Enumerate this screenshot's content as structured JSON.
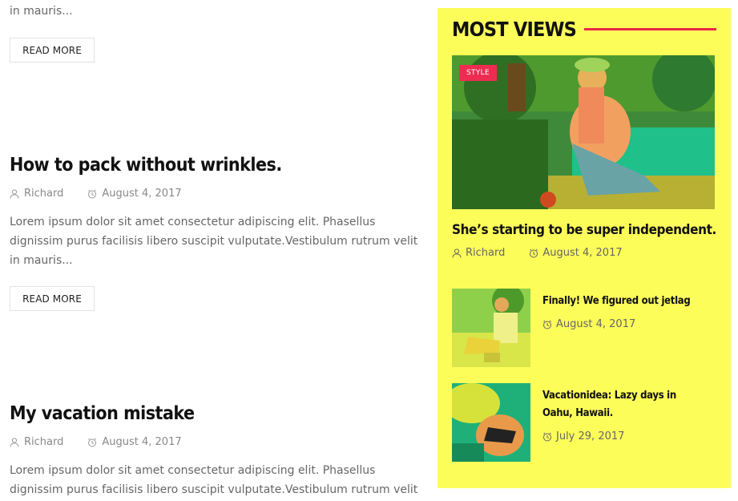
{
  "posts": [
    {
      "excerpt": "in mauris...",
      "read_more": "READ MORE"
    },
    {
      "title": "How to pack without wrinkles.",
      "author": "Richard",
      "date": "August 4, 2017",
      "excerpt": "Lorem ipsum dolor sit amet consectetur adipiscing elit. Phasellus dignissim purus facilisis libero suscipit vulputate.Vestibulum rutrum velit in mauris...",
      "read_more": "READ MORE"
    },
    {
      "title": "My vacation mistake",
      "author": "Richard",
      "date": "August 4, 2017",
      "excerpt": "Lorem ipsum dolor sit amet consectetur adipiscing elit. Phasellus dignissim purus facilisis libero suscipit vulputate.Vestibulum rutrum velit"
    }
  ],
  "sidebar": {
    "title": "MOST VIEWS",
    "accent_color": "#e8284a",
    "background": "#fdfd5a",
    "featured": {
      "tag": "STYLE",
      "title": "She’s starting to be super independent.",
      "author": "Richard",
      "date": "August 4, 2017"
    },
    "items": [
      {
        "title": "Finally! We figured out jetlag",
        "date": "August 4, 2017"
      },
      {
        "title": "Vacationidea: Lazy days in Oahu, Hawaii.",
        "date": "July 29, 2017"
      }
    ]
  }
}
